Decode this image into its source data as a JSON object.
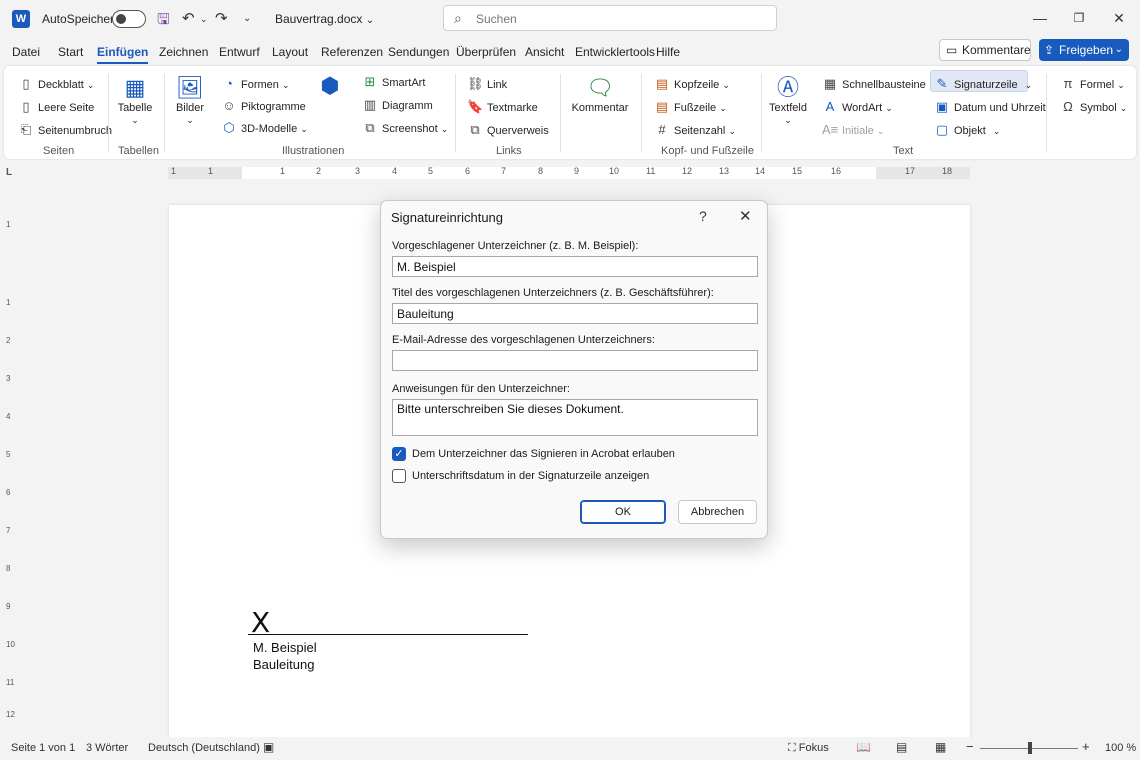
{
  "titlebar": {
    "autosave_label": "AutoSpeichern",
    "document_name": "Bauvertrag.docx",
    "search_placeholder": "Suchen"
  },
  "menu_tabs": [
    "Datei",
    "Start",
    "Einfügen",
    "Zeichnen",
    "Entwurf",
    "Layout",
    "Referenzen",
    "Sendungen",
    "Überprüfen",
    "Ansicht",
    "Entwicklertools",
    "Hilfe"
  ],
  "active_tab": "Einfügen",
  "header_buttons": {
    "comments": "Kommentare",
    "share": "Freigeben"
  },
  "ribbon": {
    "seiten": {
      "label": "Seiten",
      "deckblatt": "Deckblatt",
      "leere_seite": "Leere Seite",
      "seitenumbruch": "Seitenumbruch"
    },
    "tabellen": {
      "label": "Tabellen",
      "tabelle": "Tabelle"
    },
    "illustrationen": {
      "label": "Illustrationen",
      "bilder": "Bilder",
      "formen": "Formen",
      "piktogramme": "Piktogramme",
      "modelle": "3D-Modelle",
      "smartart": "SmartArt",
      "diagramm": "Diagramm",
      "screenshot": "Screenshot"
    },
    "links": {
      "label": "Links",
      "link": "Link",
      "textmarke": "Textmarke",
      "querverweis": "Querverweis"
    },
    "kommentare": {
      "kommentar": "Kommentar"
    },
    "kopf": {
      "label": "Kopf- und Fußzeile",
      "kopfzeile": "Kopfzeile",
      "fusszeile": "Fußzeile",
      "seitenzahl": "Seitenzahl"
    },
    "text": {
      "label": "Text",
      "textfeld": "Textfeld",
      "schnellbausteine": "Schnellbausteine",
      "wordart": "WordArt",
      "initiale": "Initiale",
      "signaturzeile": "Signaturzeile",
      "datum": "Datum und Uhrzeit",
      "objekt": "Objekt"
    },
    "symbole": {
      "formel": "Formel",
      "symbol": "Symbol"
    }
  },
  "ruler_numbers": [
    "1",
    "1",
    "1",
    "2",
    "3",
    "4",
    "5",
    "6",
    "7",
    "8",
    "9",
    "10",
    "11",
    "12",
    "13",
    "14",
    "15",
    "16",
    "17",
    "18"
  ],
  "vruler_numbers": [
    "1",
    "1",
    "2",
    "3",
    "4",
    "5",
    "6",
    "7",
    "8",
    "9",
    "10",
    "11",
    "12"
  ],
  "document": {
    "signature_mark": "X",
    "signer_name": "M. Beispiel",
    "signer_title": "Bauleitung"
  },
  "dialog": {
    "title": "Signatureinrichtung",
    "help": "?",
    "close": "✕",
    "signer_label": "Vorgeschlagener Unterzeichner (z. B. M. Beispiel):",
    "signer_value": "M. Beispiel",
    "title_label": "Titel des vorgeschlagenen Unterzeichners (z. B. Geschäftsführer):",
    "title_value": "Bauleitung",
    "email_label": "E-Mail-Adresse des vorgeschlagenen Unterzeichners:",
    "email_value": "",
    "instructions_label": "Anweisungen für den Unterzeichner:",
    "instructions_value": "Bitte unterschreiben Sie dieses Dokument.",
    "checkbox_acrobat": {
      "label": "Dem Unterzeichner das Signieren in Acrobat erlauben",
      "checked": true
    },
    "checkbox_date": {
      "label": "Unterschriftsdatum in der Signaturzeile anzeigen",
      "checked": false
    },
    "ok": "OK",
    "cancel": "Abbrechen"
  },
  "statusbar": {
    "page": "Seite 1 von 1",
    "words": "3 Wörter",
    "language": "Deutsch (Deutschland)",
    "focus": "Fokus",
    "zoom": "100 %"
  },
  "colors": {
    "accent": "#185abd",
    "background": "#f3f3f3"
  }
}
